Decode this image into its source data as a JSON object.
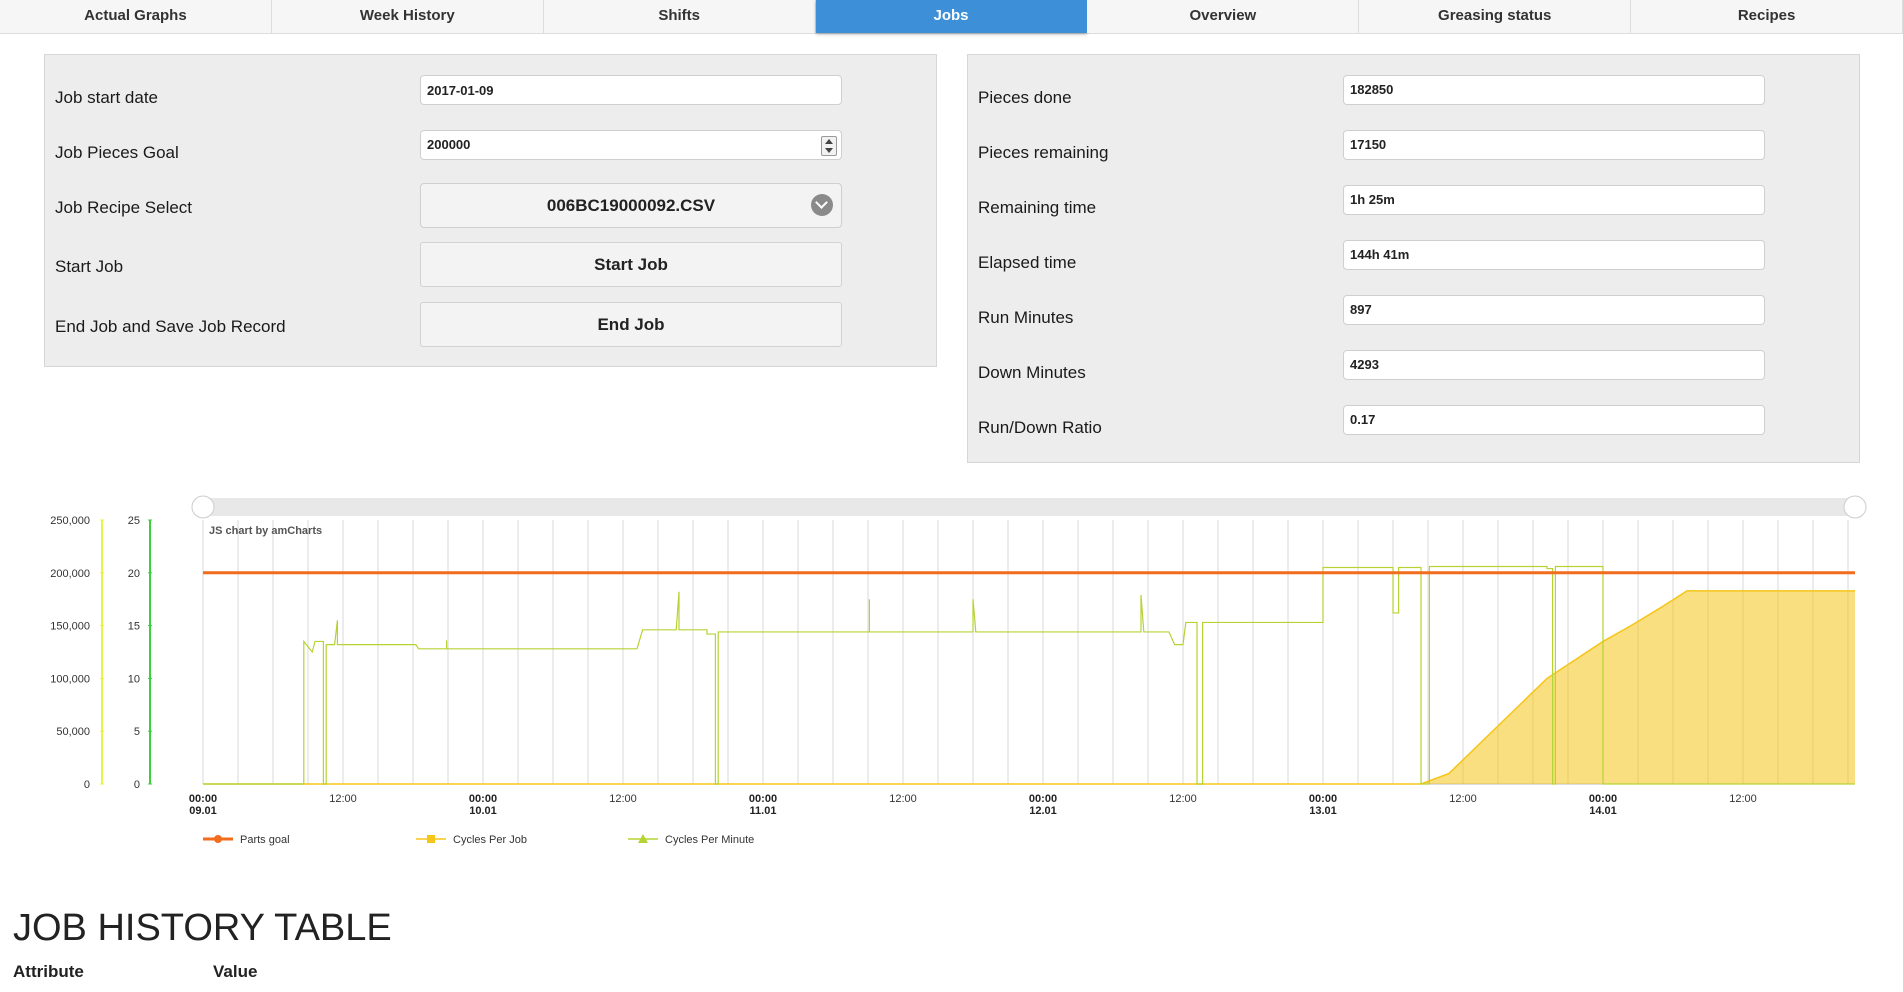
{
  "tabs": [
    "Actual Graphs",
    "Week History",
    "Shifts",
    "Jobs",
    "Overview",
    "Greasing status",
    "Recipes"
  ],
  "active_tab": "Jobs",
  "job_form": {
    "start_date_label": "Job start date",
    "start_date_value": "2017-01-09",
    "goal_label": "Job Pieces Goal",
    "goal_value": "200000",
    "recipe_label": "Job Recipe Select",
    "recipe_value": "006BC19000092.CSV",
    "start_label": "Start Job",
    "start_button": "Start Job",
    "end_label": "End Job and Save Job Record",
    "end_button": "End Job"
  },
  "stats": [
    {
      "label": "Pieces done",
      "value": "182850"
    },
    {
      "label": "Pieces remaining",
      "value": "17150"
    },
    {
      "label": "Remaining time",
      "value": "1h 25m"
    },
    {
      "label": "Elapsed time",
      "value": "144h 41m"
    },
    {
      "label": "Run Minutes",
      "value": "897"
    },
    {
      "label": "Down Minutes",
      "value": "4293"
    },
    {
      "label": "Run/Down Ratio",
      "value": "0.17"
    }
  ],
  "chart_data": {
    "type": "line",
    "credit": "JS chart by amCharts",
    "y_left_ticks": [
      "250,000",
      "200,000",
      "150,000",
      "100,000",
      "50,000",
      "0"
    ],
    "y_right_ticks": [
      "25",
      "20",
      "15",
      "10",
      "5",
      "0"
    ],
    "ylim_pieces": [
      0,
      250000
    ],
    "ylim_cycles": [
      0,
      25
    ],
    "x_range_days": [
      0,
      5.9
    ],
    "x_ticks": [
      {
        "t": 0,
        "l1": "00:00",
        "l2": "09.01"
      },
      {
        "t": 0.5,
        "l1": "12:00",
        "l2": ""
      },
      {
        "t": 1,
        "l1": "00:00",
        "l2": "10.01"
      },
      {
        "t": 1.5,
        "l1": "12:00",
        "l2": ""
      },
      {
        "t": 2,
        "l1": "00:00",
        "l2": "11.01"
      },
      {
        "t": 2.5,
        "l1": "12:00",
        "l2": ""
      },
      {
        "t": 3,
        "l1": "00:00",
        "l2": "12.01"
      },
      {
        "t": 3.5,
        "l1": "12:00",
        "l2": ""
      },
      {
        "t": 4,
        "l1": "00:00",
        "l2": "13.01"
      },
      {
        "t": 4.5,
        "l1": "12:00",
        "l2": ""
      },
      {
        "t": 5,
        "l1": "00:00",
        "l2": "14.01"
      },
      {
        "t": 5.5,
        "l1": "12:00",
        "l2": ""
      }
    ],
    "series": [
      {
        "name": "Parts goal",
        "color": "#f26c1d",
        "points": [
          [
            0,
            200000
          ],
          [
            5.9,
            200000
          ]
        ]
      },
      {
        "name": "Cycles Per Job",
        "color": "#f5c518",
        "points": [
          [
            0,
            0
          ],
          [
            4.35,
            0
          ],
          [
            4.45,
            10000
          ],
          [
            4.8,
            100000
          ],
          [
            5.0,
            135000
          ],
          [
            5.1,
            150000
          ],
          [
            5.2,
            166000
          ],
          [
            5.3,
            182850
          ],
          [
            5.9,
            182850
          ]
        ]
      },
      {
        "name": "Cycles Per Minute",
        "color": "#b5d334",
        "points": [
          [
            0,
            0
          ],
          [
            0.36,
            0
          ],
          [
            0.36,
            13.5
          ],
          [
            0.39,
            12.5
          ],
          [
            0.4,
            13.5
          ],
          [
            0.43,
            13.5
          ],
          [
            0.43,
            0
          ],
          [
            0.44,
            0
          ],
          [
            0.44,
            13.2
          ],
          [
            0.47,
            13.2
          ],
          [
            0.48,
            15.5
          ],
          [
            0.48,
            13.2
          ],
          [
            0.76,
            13.2
          ],
          [
            0.77,
            12.8
          ],
          [
            0.87,
            12.8
          ],
          [
            0.87,
            13.6
          ],
          [
            0.87,
            12.8
          ],
          [
            1.55,
            12.8
          ],
          [
            1.57,
            14.6
          ],
          [
            1.69,
            14.6
          ],
          [
            1.7,
            18.2
          ],
          [
            1.7,
            14.6
          ],
          [
            1.8,
            14.6
          ],
          [
            1.8,
            14.2
          ],
          [
            1.83,
            14.2
          ],
          [
            1.83,
            0
          ],
          [
            1.84,
            0
          ],
          [
            1.84,
            14.4
          ],
          [
            2.38,
            14.4
          ],
          [
            2.38,
            17.5
          ],
          [
            2.38,
            14.4
          ],
          [
            2.75,
            14.4
          ],
          [
            2.75,
            17.5
          ],
          [
            2.76,
            14.4
          ],
          [
            3.35,
            14.4
          ],
          [
            3.35,
            17.9
          ],
          [
            3.36,
            14.4
          ],
          [
            3.45,
            14.4
          ],
          [
            3.47,
            13.2
          ],
          [
            3.5,
            13.2
          ],
          [
            3.51,
            15.3
          ],
          [
            3.55,
            15.3
          ],
          [
            3.55,
            0
          ],
          [
            3.57,
            0
          ],
          [
            3.57,
            15.3
          ],
          [
            4.0,
            15.3
          ],
          [
            4.0,
            20.5
          ],
          [
            4.25,
            20.5
          ],
          [
            4.25,
            16.2
          ],
          [
            4.27,
            16.2
          ],
          [
            4.27,
            20.5
          ],
          [
            4.35,
            20.5
          ],
          [
            4.35,
            0
          ],
          [
            4.38,
            0
          ],
          [
            4.38,
            20.6
          ],
          [
            4.8,
            20.6
          ],
          [
            4.8,
            20.4
          ],
          [
            4.82,
            20.4
          ],
          [
            4.82,
            0
          ],
          [
            4.83,
            0
          ],
          [
            4.83,
            20.6
          ],
          [
            5.0,
            20.6
          ],
          [
            5.0,
            0
          ],
          [
            5.9,
            0
          ]
        ]
      }
    ],
    "legend": [
      {
        "name": "Parts goal",
        "color": "#f26c1d",
        "marker": "circle"
      },
      {
        "name": "Cycles Per Job",
        "color": "#f5c518",
        "marker": "square"
      },
      {
        "name": "Cycles Per Minute",
        "color": "#b5d334",
        "marker": "triangle"
      }
    ]
  },
  "history": {
    "title": "JOB HISTORY TABLE",
    "col_attribute": "Attribute",
    "col_value": "Value"
  }
}
